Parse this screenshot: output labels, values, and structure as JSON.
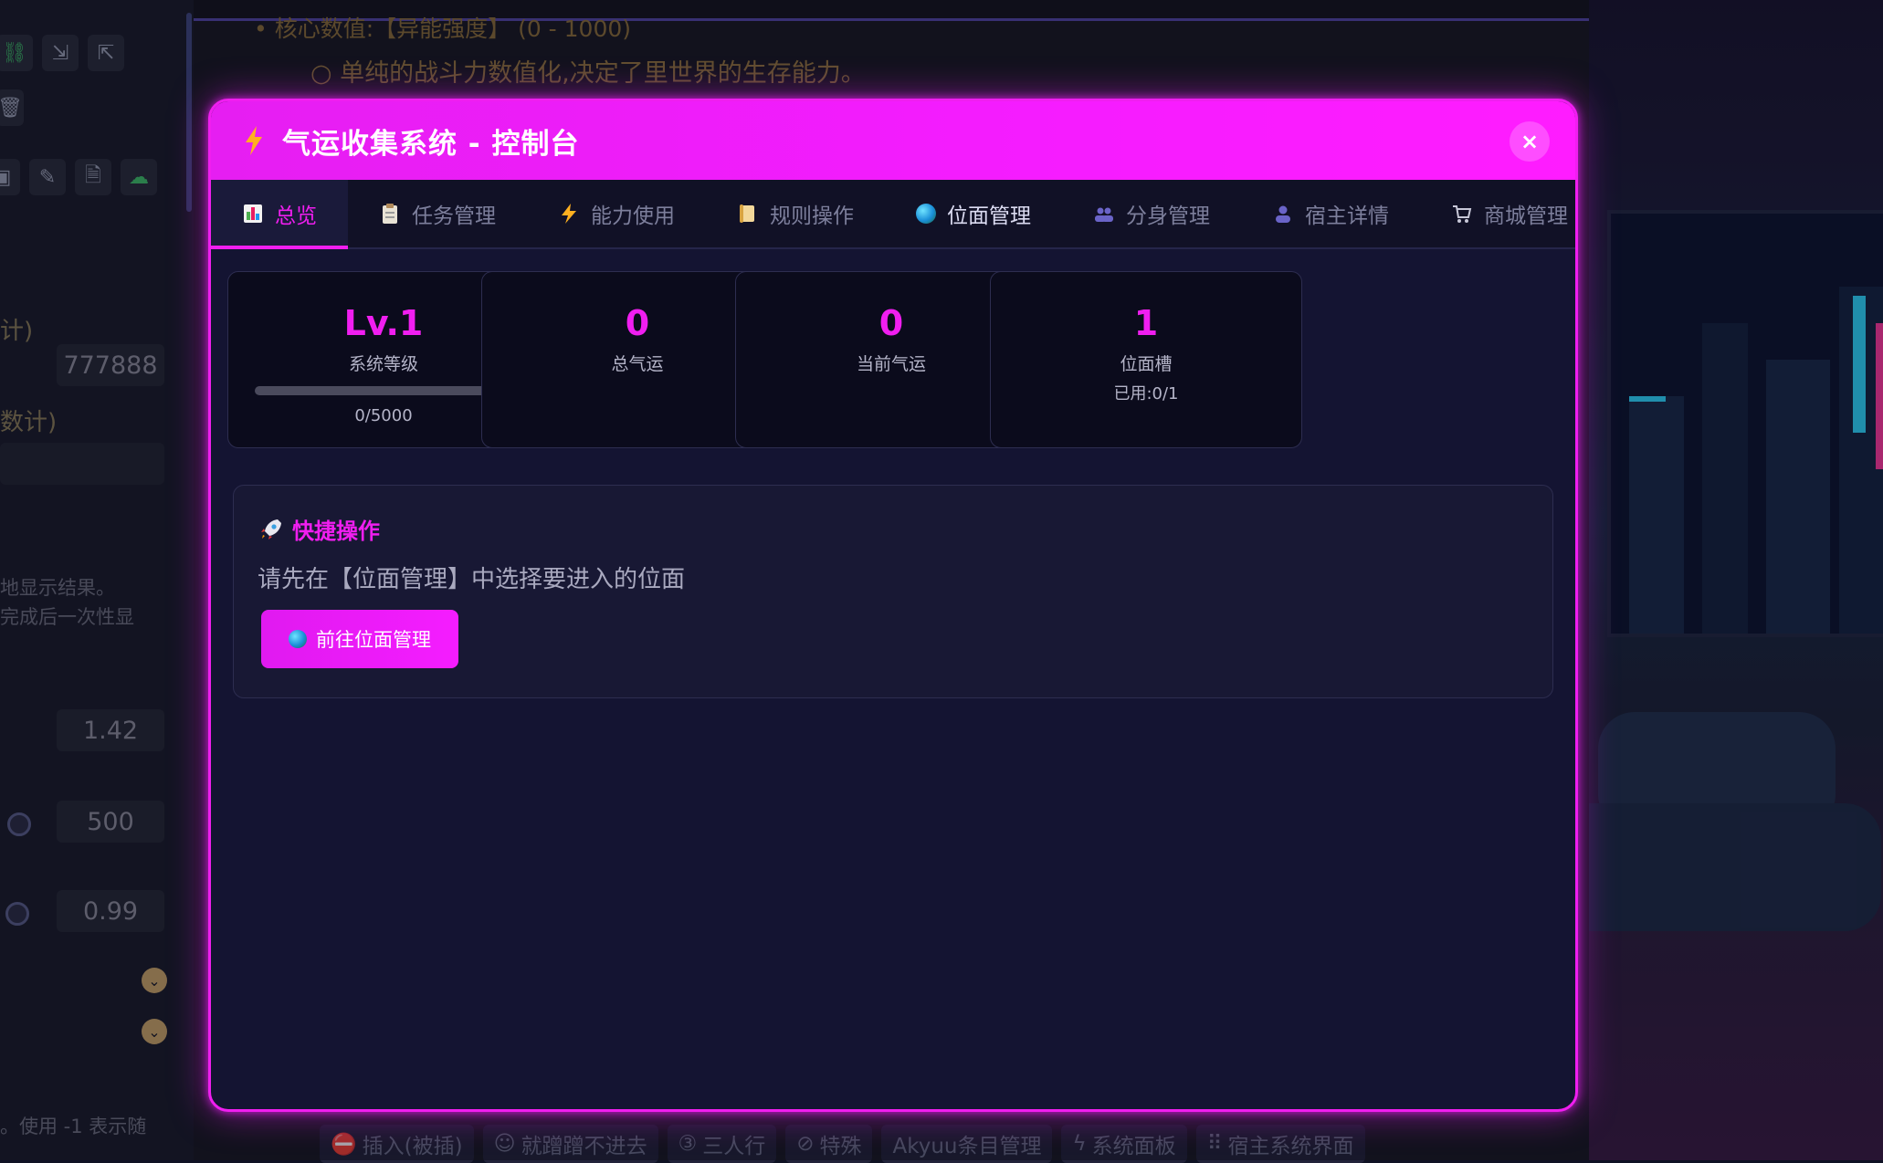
{
  "left_panel": {
    "text_1": "计)",
    "input_1": "777888",
    "text_2": "数计)",
    "note_1": "地显示结果。",
    "note_2": "完成后一次性显",
    "input_2": "1.42",
    "input_3": "500",
    "input_4": "0.99",
    "note_3": "。使用 -1 表示随"
  },
  "chat": {
    "line_1": "• 核心数值:【异能强度】 (0 - 1000)",
    "line_2": "○ 单纯的战斗力数值化,决定了里世界的生存能力。"
  },
  "bottom_bar": [
    {
      "icon": "no-entry-icon",
      "label": "插入(被插)"
    },
    {
      "icon": "face-icon",
      "label": "就蹭蹭不进去"
    },
    {
      "icon": "keycap-3-icon",
      "label": "三人行"
    },
    {
      "icon": "prohibited-icon",
      "label": "特殊"
    },
    {
      "icon": "",
      "label": "Akyuu条目管理"
    },
    {
      "icon": "bolt-icon",
      "label": "系统面板"
    },
    {
      "icon": "grid-icon",
      "label": "宿主系统界面"
    }
  ],
  "modal": {
    "title": "气运收集系统 - 控制台",
    "close_label": "×",
    "accent_color": "#f01ef0",
    "tabs": [
      {
        "label": "总览",
        "icon": "bar-chart-icon",
        "active": true
      },
      {
        "label": "任务管理",
        "icon": "clipboard-icon"
      },
      {
        "label": "能力使用",
        "icon": "bolt-icon"
      },
      {
        "label": "规则操作",
        "icon": "scroll-icon"
      },
      {
        "label": "位面管理",
        "icon": "globe-icon"
      },
      {
        "label": "分身管理",
        "icon": "people-icon"
      },
      {
        "label": "宿主详情",
        "icon": "person-icon"
      },
      {
        "label": "商城管理",
        "icon": "cart-icon"
      }
    ],
    "stats": {
      "level": {
        "value": "Lv.1",
        "label": "系统等级",
        "progress": "0/5000",
        "progress_fraction": 0
      },
      "total_luck": {
        "value": "0",
        "label": "总气运"
      },
      "current_luck": {
        "value": "0",
        "label": "当前气运"
      },
      "plane_slots": {
        "value": "1",
        "label": "位面槽",
        "sub": "已用:0/1"
      }
    },
    "quick": {
      "title": "快捷操作",
      "title_icon": "rocket-icon",
      "text": "请先在【位面管理】中选择要进入的位面",
      "button_label": "前往位面管理",
      "button_icon": "globe-icon"
    }
  }
}
